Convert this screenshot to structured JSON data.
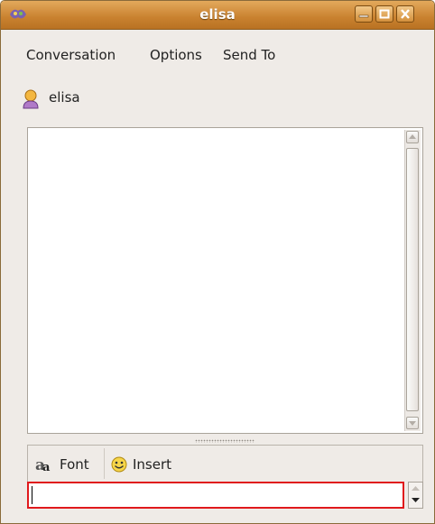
{
  "window": {
    "title": "elisa"
  },
  "menu": {
    "conversation": "Conversation",
    "options": "Options",
    "send_to": "Send To"
  },
  "contact": {
    "name": "elisa"
  },
  "toolbar": {
    "font_label": "Font",
    "insert_label": "Insert"
  },
  "message_input": {
    "value": ""
  },
  "colors": {
    "titlebar": "#c9812f",
    "focus_border": "#e0191c",
    "window_bg": "#efebe7"
  }
}
